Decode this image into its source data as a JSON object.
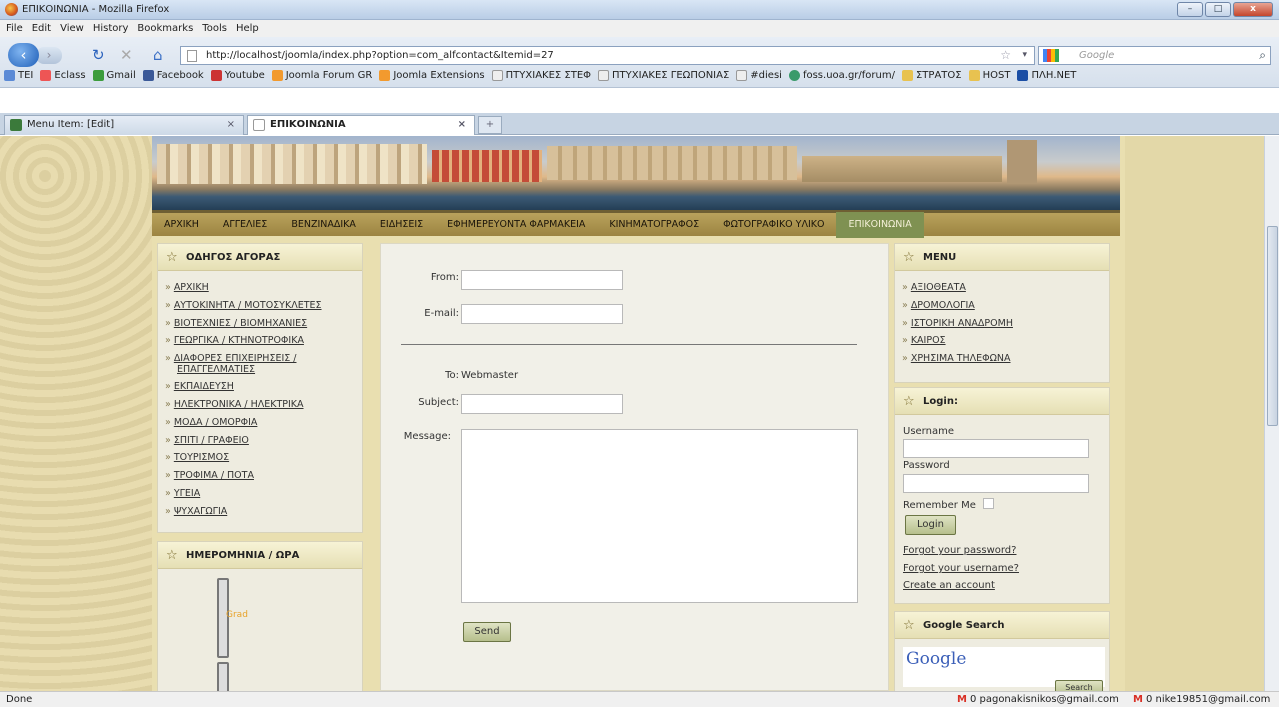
{
  "window": {
    "title": "ΕΠΙΚΟΙΝΩΝΙΑ - Mozilla Firefox",
    "min": "–",
    "max": "□",
    "close": "x"
  },
  "menu": [
    "File",
    "Edit",
    "View",
    "History",
    "Bookmarks",
    "Tools",
    "Help"
  ],
  "nav": {
    "url": "http://localhost/joomla/index.php?option=com_alfcontact&Itemid=27",
    "search_placeholder": "Google"
  },
  "bookmarks": [
    "TEI",
    "Eclass",
    "Gmail",
    "Facebook",
    "Youtube",
    "Joomla Forum GR",
    "Joomla Extensions",
    "ΠΤΥΧΙΑΚΕΣ ΣΤΕΦ",
    "ΠΤΥΧΙΑΚΕΣ ΓΕΩΠΟΝΙΑΣ",
    "#diesi",
    "foss.uoa.gr/forum/",
    "ΣΤΡΑΤΟΣ",
    "HOST",
    "ΠΛΗ.ΝΕΤ"
  ],
  "tabs": [
    {
      "label": "Menu Item: [Edit]"
    },
    {
      "label": "ΕΠΙΚΟΙΝΩΝΙΑ"
    }
  ],
  "site_nav": [
    "ΑΡΧΙΚΗ",
    "ΑΓΓΕΛΙΕΣ",
    "ΒΕΝΖΙΝΑΔΙΚΑ",
    "ΕΙΔΗΣΕΙΣ",
    "ΕΦΗΜΕΡΕΥΟΝΤΑ ΦΑΡΜΑΚΕΙΑ",
    "ΚΙΝΗΜΑΤΟΓΡΑΦΟΣ",
    "ΦΩΤΟΓΡΑΦΙΚΟ ΥΛΙΚΟ",
    "ΕΠΙΚΟΙΝΩΝΙΑ"
  ],
  "left_module": {
    "title": "ΟΔΗΓΟΣ ΑΓΟΡΑΣ",
    "items": [
      "ΑΡΧΙΚΗ",
      "ΑΥΤΟΚΙΝΗΤΑ / ΜΟΤΟΣΥΚΛΕΤΕΣ",
      "ΒΙΟΤΕΧΝΙΕΣ / ΒΙΟΜΗΧΑΝΙΕΣ",
      "ΓΕΩΡΓΙΚΑ / ΚΤΗΝΟΤΡΟΦΙΚΑ",
      "ΔΙΑΦΟΡΕΣ ΕΠΙΧΕΙΡΗΣΕΙΣ /",
      "ΕΠΑΓΓΕΛΜΑΤΙΕΣ",
      "ΕΚΠΑΙΔΕΥΣΗ",
      "ΗΛΕΚΤΡΟΝΙΚΑ / ΗΛΕΚΤΡΙΚΑ",
      "ΜΟΔΑ / ΟΜΟΡΦΙΑ",
      "ΣΠΙΤΙ / ΓΡΑΦΕΙΟ",
      "ΤΟΥΡΙΣΜΟΣ",
      "ΤΡΟΦΙΜΑ / ΠΟΤΑ",
      "ΥΓΕΙΑ",
      "ΨΥΧΑΓΩΓΙΑ"
    ]
  },
  "date_module": {
    "title": "ΗΜΕΡΟΜΗΝΙΑ / ΩΡΑ",
    "clock_text": "Grad"
  },
  "form": {
    "from_label": "From:",
    "email_label": "E-mail:",
    "to_label": "To:",
    "to_value": "Webmaster",
    "subject_label": "Subject:",
    "message_label": "Message:",
    "send": "Send"
  },
  "right_menu": {
    "title": "MENU",
    "items": [
      "ΑΞΙΟΘΕΑΤΑ",
      "ΔΡΟΜΟΛΟΓΙΑ",
      "ΙΣΤΟΡΙΚΗ ΑΝΑΔΡΟΜΗ",
      "ΚΑΙΡΟΣ",
      "ΧΡΗΣΙΜΑ ΤΗΛΕΦΩΝΑ"
    ]
  },
  "login": {
    "title": "Login:",
    "username": "Username",
    "password": "Password",
    "remember": "Remember Me",
    "button": "Login",
    "forgot_password": "Forgot your password?",
    "forgot_username": "Forgot your username?",
    "create": "Create an account"
  },
  "google_search": {
    "title": "Google Search",
    "logo": "Google",
    "button": "Search"
  },
  "status": {
    "text": "Done",
    "mail1": "0 pagonakisnikos@gmail.com",
    "mail2": "0 nike19851@gmail.com"
  }
}
